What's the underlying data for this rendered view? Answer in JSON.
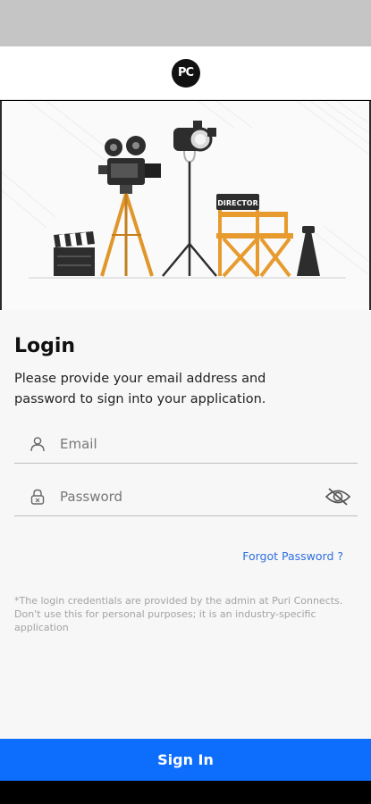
{
  "header": {
    "logo_text": "PC"
  },
  "login": {
    "title": "Login",
    "description": "Please provide your email address and password to sign into your application.",
    "email_placeholder": "Email",
    "password_placeholder": "Password",
    "forgot_label": "Forgot Password ?",
    "disclaimer": "*The login credentials are provided by the admin at Puri Connects. Don't use this for personal purposes; it is an industry-specific application",
    "signin_label": "Sign In"
  },
  "hero": {
    "chair_label": "DIRECTOR"
  },
  "colors": {
    "primary": "#0d6efd",
    "link": "#2f6fe0",
    "chair": "#e79b2e"
  }
}
